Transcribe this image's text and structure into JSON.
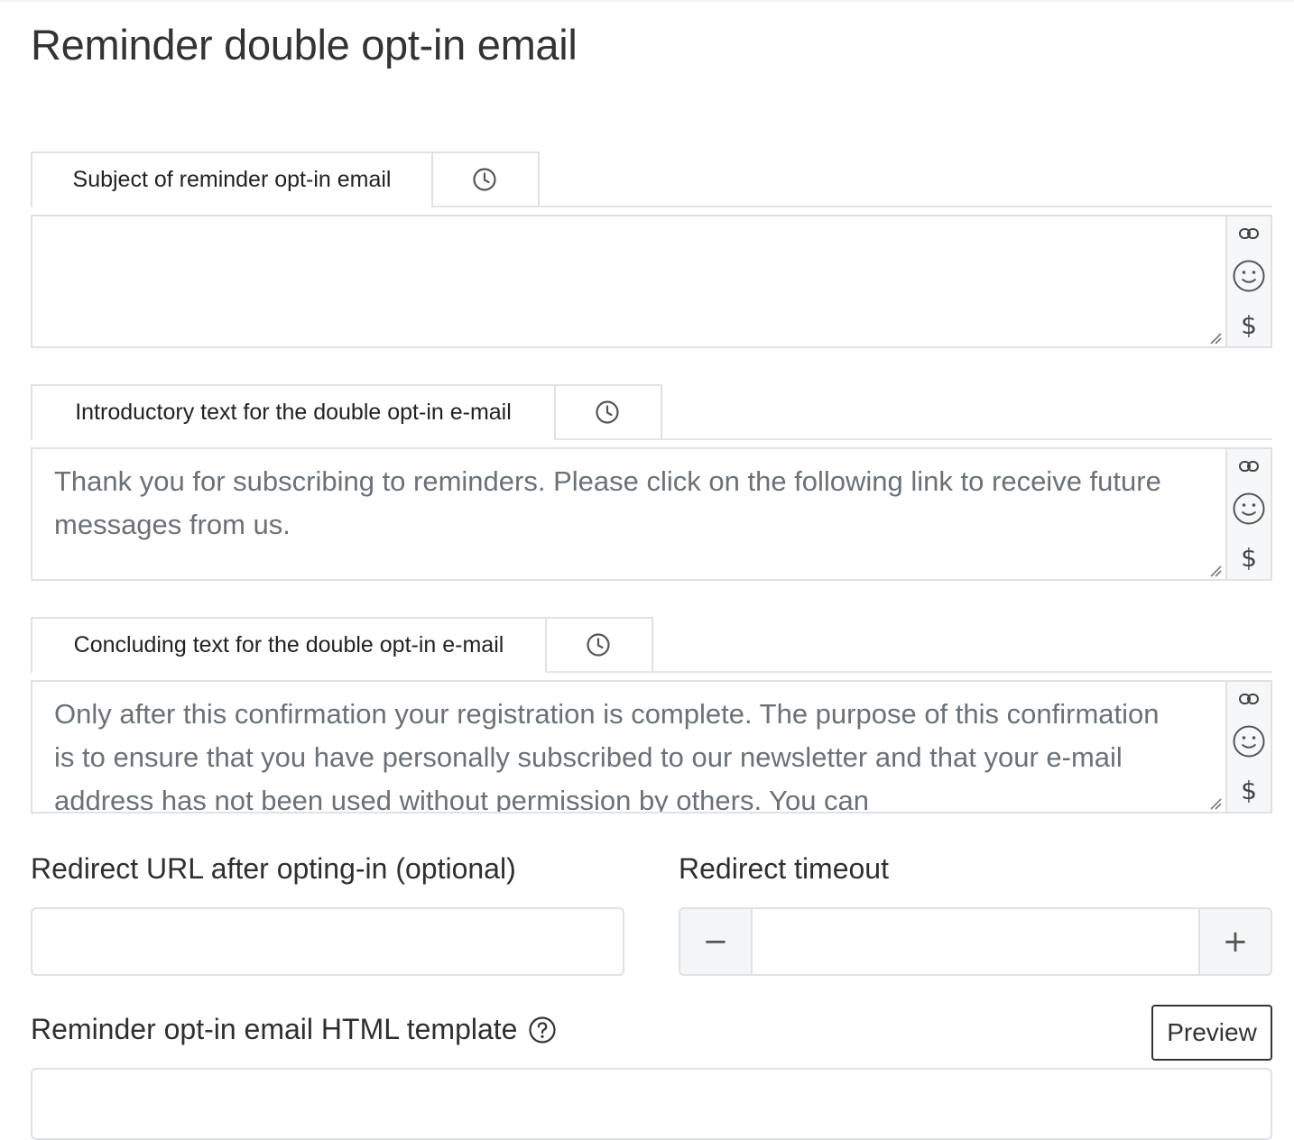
{
  "page": {
    "title": "Reminder double opt-in email"
  },
  "sections": [
    {
      "tab_label": "Subject of reminder opt-in email",
      "text": ""
    },
    {
      "tab_label": "Introductory text for the double opt-in e-mail",
      "text": "Thank you for subscribing to reminders. Please click on the following link to receive future messages from us."
    },
    {
      "tab_label": "Concluding text for the double opt-in e-mail",
      "text": "Only after this confirmation your registration is complete. The purpose of this confirmation is to ensure that you have personally subscribed to our newsletter and that your e-mail address has not been used without permission by others. You can"
    }
  ],
  "editor_tools": {
    "link_icon": "link-icon",
    "emoji_icon": "smiley-icon",
    "variable_symbol": "$"
  },
  "redirect_url": {
    "label": "Redirect URL after opting-in (optional)",
    "value": ""
  },
  "redirect_timeout": {
    "label": "Redirect timeout",
    "value": "",
    "decrement": "−",
    "increment": "+"
  },
  "template": {
    "label": "Reminder opt-in email HTML template",
    "help_icon": "question-circle-icon",
    "preview_label": "Preview",
    "value": ""
  }
}
